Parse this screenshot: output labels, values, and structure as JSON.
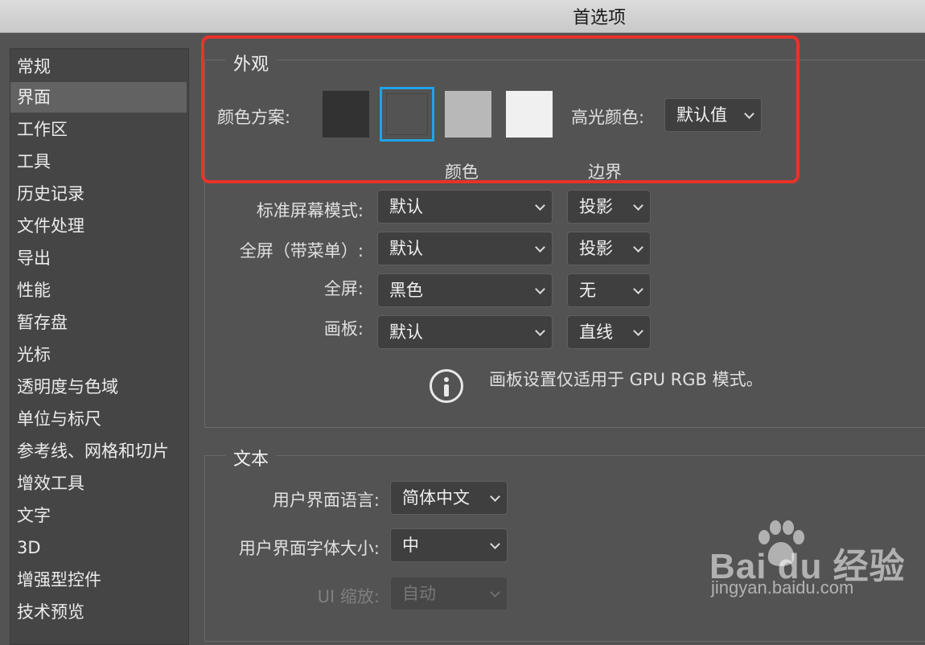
{
  "window": {
    "title": "首选项"
  },
  "sidebar": {
    "items": [
      {
        "label": "常规"
      },
      {
        "label": "界面"
      },
      {
        "label": "工作区"
      },
      {
        "label": "工具"
      },
      {
        "label": "历史记录"
      },
      {
        "label": "文件处理"
      },
      {
        "label": "导出"
      },
      {
        "label": "性能"
      },
      {
        "label": "暂存盘"
      },
      {
        "label": "光标"
      },
      {
        "label": "透明度与色域"
      },
      {
        "label": "单位与标尺"
      },
      {
        "label": "参考线、网格和切片"
      },
      {
        "label": "增效工具"
      },
      {
        "label": "文字"
      },
      {
        "label": "3D"
      },
      {
        "label": "增强型控件"
      },
      {
        "label": "技术预览"
      }
    ],
    "selected": "界面"
  },
  "appearance": {
    "legend": "外观",
    "color_scheme_label": "颜色方案:",
    "swatches": [
      {
        "color": "#323232",
        "selected": false
      },
      {
        "color": "#535353",
        "selected": true
      },
      {
        "color": "#b8b8b8",
        "selected": false
      },
      {
        "color": "#f0f0f0",
        "selected": false
      }
    ],
    "highlight_label": "高光颜色:",
    "highlight_value": "默认值",
    "col_color": "颜色",
    "col_border": "边界",
    "rows": [
      {
        "label": "标准屏幕模式:",
        "color": "默认",
        "border": "投影"
      },
      {
        "label": "全屏（带菜单）:",
        "color": "默认",
        "border": "投影"
      },
      {
        "label": "全屏:",
        "color": "黑色",
        "border": "无"
      },
      {
        "label": "画板:",
        "color": "默认",
        "border": "直线"
      }
    ],
    "info_text": "画板设置仅适用于 GPU RGB 模式。"
  },
  "text_section": {
    "legend": "文本",
    "ui_language_label": "用户界面语言:",
    "ui_language_value": "简体中文",
    "ui_font_size_label": "用户界面字体大小:",
    "ui_font_size_value": "中",
    "ui_scale_label": "UI 缩放:",
    "ui_scale_value": "自动"
  },
  "watermark": {
    "brand": "Bai du 经验",
    "url": "jingyan.baidu.com"
  },
  "colors": {
    "highlight_ring": "#1fa3e6",
    "annotation_red": "#e8332a",
    "panel": "#535353"
  }
}
